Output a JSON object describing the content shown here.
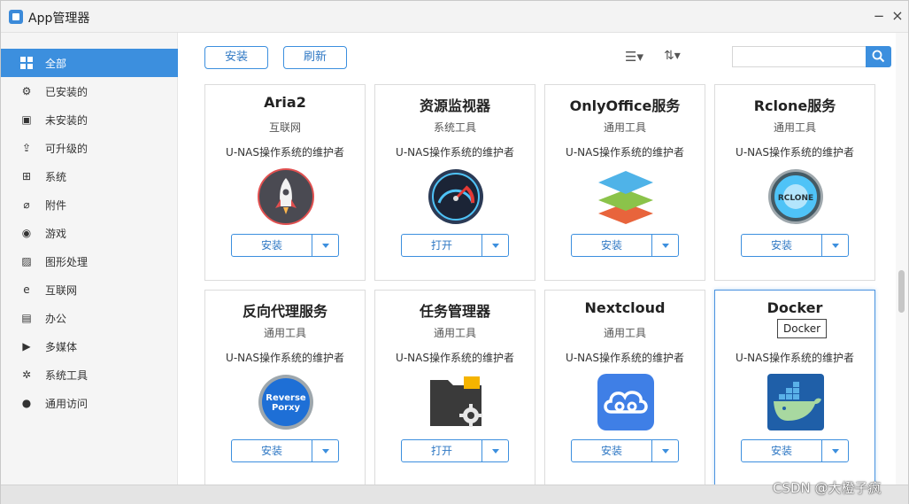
{
  "window": {
    "title": "App管理器",
    "minimize": "−",
    "close": "×"
  },
  "sidebar": {
    "items": [
      {
        "label": "全部",
        "icon": "grid-icon",
        "glyph": "",
        "active": true
      },
      {
        "label": "已安装的",
        "icon": "installed-icon",
        "glyph": "⚙"
      },
      {
        "label": "未安装的",
        "icon": "package-icon",
        "glyph": "▣"
      },
      {
        "label": "可升级的",
        "icon": "upgrade-icon",
        "glyph": "⇪"
      },
      {
        "label": "系统",
        "icon": "windows-icon",
        "glyph": "⊞"
      },
      {
        "label": "附件",
        "icon": "attachment-icon",
        "glyph": "⌀"
      },
      {
        "label": "游戏",
        "icon": "gamepad-icon",
        "glyph": "◉"
      },
      {
        "label": "图形处理",
        "icon": "image-icon",
        "glyph": "▨"
      },
      {
        "label": "互联网",
        "icon": "internet-icon",
        "glyph": "e"
      },
      {
        "label": "办公",
        "icon": "briefcase-icon",
        "glyph": "▤"
      },
      {
        "label": "多媒体",
        "icon": "play-icon",
        "glyph": "▶"
      },
      {
        "label": "系统工具",
        "icon": "gear-icon",
        "glyph": "✲"
      },
      {
        "label": "通用访问",
        "icon": "user-icon",
        "glyph": "●"
      }
    ]
  },
  "toolbar": {
    "install_label": "安装",
    "refresh_label": "刷新",
    "list_view_glyph": "☰▾",
    "sort_glyph": "⇅▾",
    "search_placeholder": ""
  },
  "apps": [
    {
      "name": "Aria2",
      "category": "互联网",
      "maintainer": "U-NAS操作系统的维护者",
      "action": "安装",
      "logo": "rocket-icon"
    },
    {
      "name": "资源监视器",
      "category": "系统工具",
      "maintainer": "U-NAS操作系统的维护者",
      "action": "打开",
      "logo": "speedometer-icon"
    },
    {
      "name": "OnlyOffice服务",
      "category": "通用工具",
      "maintainer": "U-NAS操作系统的维护者",
      "action": "安装",
      "logo": "layers-icon"
    },
    {
      "name": "Rclone服务",
      "category": "通用工具",
      "maintainer": "U-NAS操作系统的维护者",
      "action": "安装",
      "logo": "rclone-icon",
      "logo_text": "RCLONE"
    },
    {
      "name": "反向代理服务",
      "category": "通用工具",
      "maintainer": "U-NAS操作系统的维护者",
      "action": "安装",
      "logo": "reverse-proxy-icon",
      "logo_text_1": "Reverse",
      "logo_text_2": "Porxy"
    },
    {
      "name": "任务管理器",
      "category": "通用工具",
      "maintainer": "U-NAS操作系统的维护者",
      "action": "打开",
      "logo": "folder-gear-icon"
    },
    {
      "name": "Nextcloud",
      "category": "通用工具",
      "maintainer": "U-NAS操作系统的维护者",
      "action": "安装",
      "logo": "cloud-icon"
    },
    {
      "name": "Docker",
      "category": "",
      "maintainer": "U-NAS操作系统的维护者",
      "action": "安装",
      "logo": "docker-icon",
      "tooltip": "Docker"
    }
  ],
  "watermark": "CSDN @大橙子疯",
  "colors": {
    "accent": "#3c8fde",
    "sidebar_bg": "#f5f5f5",
    "title_bg": "#f3f3f3"
  }
}
